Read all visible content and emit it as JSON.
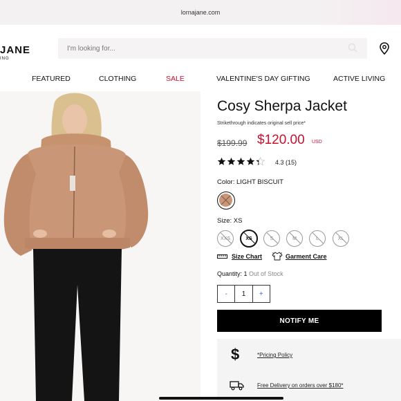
{
  "browser": {
    "url": "lornajane.com"
  },
  "header": {
    "logo": "JANE",
    "logo_sub": "ING",
    "search_placeholder": "I'm looking for..."
  },
  "nav": [
    "FEATURED",
    "CLOTHING",
    "SALE",
    "VALENTINE'S DAY GIFTING",
    "ACTIVE LIVING"
  ],
  "product": {
    "title": "Cosy Sherpa Jacket",
    "strike_note": "Strikethrough indicates original sell price*",
    "original_price": "$199.99",
    "price": "$120.00",
    "currency": "USD",
    "rating_value": 4.3,
    "rating_text": "4.3 (15)",
    "color_label": "Color: LIGHT BISCUIT",
    "swatch_color": "#c99677",
    "size_label": "Size: XS",
    "sizes": [
      {
        "label": "XXS",
        "selected": false,
        "unavailable": true
      },
      {
        "label": "XS",
        "selected": true,
        "unavailable": true
      },
      {
        "label": "S",
        "selected": false,
        "unavailable": true
      },
      {
        "label": "M",
        "selected": false,
        "unavailable": true
      },
      {
        "label": "L",
        "selected": false,
        "unavailable": true
      },
      {
        "label": "XL",
        "selected": false,
        "unavailable": true
      }
    ],
    "size_chart_link": "Size Chart",
    "garment_care_link": "Garment Care",
    "quantity_label": "Quantity: 1",
    "stock_status": "Out of Stock",
    "qty_minus": "-",
    "qty_value": "1",
    "qty_plus": "+",
    "notify_button": "NOTIFY ME"
  },
  "info": {
    "pricing_policy": "*Pricing Policy",
    "delivery": "Free Delivery on orders over $180*"
  },
  "colors": {
    "sale_red": "#c8102e",
    "accent_blue": "#2a6fc7",
    "black": "#000000"
  }
}
